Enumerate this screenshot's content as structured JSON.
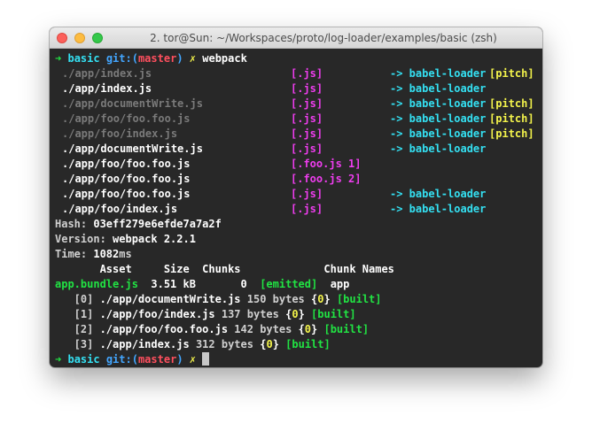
{
  "window": {
    "title": "2. tor@Sun: ~/Workspaces/proto/log-loader/examples/basic (zsh)"
  },
  "prompt": {
    "arrow": "➜",
    "dir": "basic",
    "git_open": "git:(",
    "branch": "master",
    "git_close": ")",
    "dirty": "✗",
    "command": "webpack"
  },
  "loader_lines": [
    {
      "path": "./app/index.js",
      "dim": true,
      "ext": "[.js]",
      "loader": "-> babel-loader",
      "pitch": "[pitch]"
    },
    {
      "path": "./app/index.js",
      "dim": false,
      "ext": "[.js]",
      "loader": "-> babel-loader",
      "pitch": ""
    },
    {
      "path": "./app/documentWrite.js",
      "dim": true,
      "ext": "[.js]",
      "loader": "-> babel-loader",
      "pitch": "[pitch]"
    },
    {
      "path": "./app/foo/foo.foo.js",
      "dim": true,
      "ext": "[.js]",
      "loader": "-> babel-loader",
      "pitch": "[pitch]"
    },
    {
      "path": "./app/foo/index.js",
      "dim": true,
      "ext": "[.js]",
      "loader": "-> babel-loader",
      "pitch": "[pitch]"
    },
    {
      "path": "./app/documentWrite.js",
      "dim": false,
      "ext": "[.js]",
      "loader": "-> babel-loader",
      "pitch": ""
    },
    {
      "path": "./app/foo/foo.foo.js",
      "dim": false,
      "ext": "[.foo.js 1]",
      "loader": "",
      "pitch": ""
    },
    {
      "path": "./app/foo/foo.foo.js",
      "dim": false,
      "ext": "[.foo.js 2]",
      "loader": "",
      "pitch": ""
    },
    {
      "path": "./app/foo/foo.foo.js",
      "dim": false,
      "ext": "[.js]",
      "loader": "-> babel-loader",
      "pitch": ""
    },
    {
      "path": "./app/foo/index.js",
      "dim": false,
      "ext": "[.js]",
      "loader": "-> babel-loader",
      "pitch": ""
    }
  ],
  "stats": {
    "hash_label": "Hash: ",
    "hash": "03eff279e6efde7a7a2f",
    "version_label": "Version: ",
    "version": "webpack 2.2.1",
    "time_label": "Time: ",
    "time": "1082",
    "time_unit": "ms"
  },
  "asset_table": {
    "header": "       Asset     Size  Chunks             Chunk Names",
    "asset": "app.bundle.js",
    "size": "  3.51 kB",
    "chunk": "       0",
    "emitted": "[emitted]",
    "chunk_name": "app"
  },
  "modules": [
    {
      "id": "   [0] ",
      "path": "./app/documentWrite.js",
      "size": " 150 bytes ",
      "chunk": "0",
      "built": "[built]"
    },
    {
      "id": "   [1] ",
      "path": "./app/foo/index.js",
      "size": " 137 bytes ",
      "chunk": "0",
      "built": "[built]"
    },
    {
      "id": "   [2] ",
      "path": "./app/foo/foo.foo.js",
      "size": " 142 bytes ",
      "chunk": "0",
      "built": "[built]"
    },
    {
      "id": "   [3] ",
      "path": "./app/index.js",
      "size": " 312 bytes ",
      "chunk": "0",
      "built": "[built]"
    }
  ],
  "colors": {
    "background": "#282828",
    "green": "#21e343",
    "cyan": "#34e0f2",
    "blue": "#43a6ff",
    "red": "#ff4f5e",
    "yellow": "#f3f34b",
    "magenta": "#ee3dee",
    "dim": "#7a7a7a"
  }
}
